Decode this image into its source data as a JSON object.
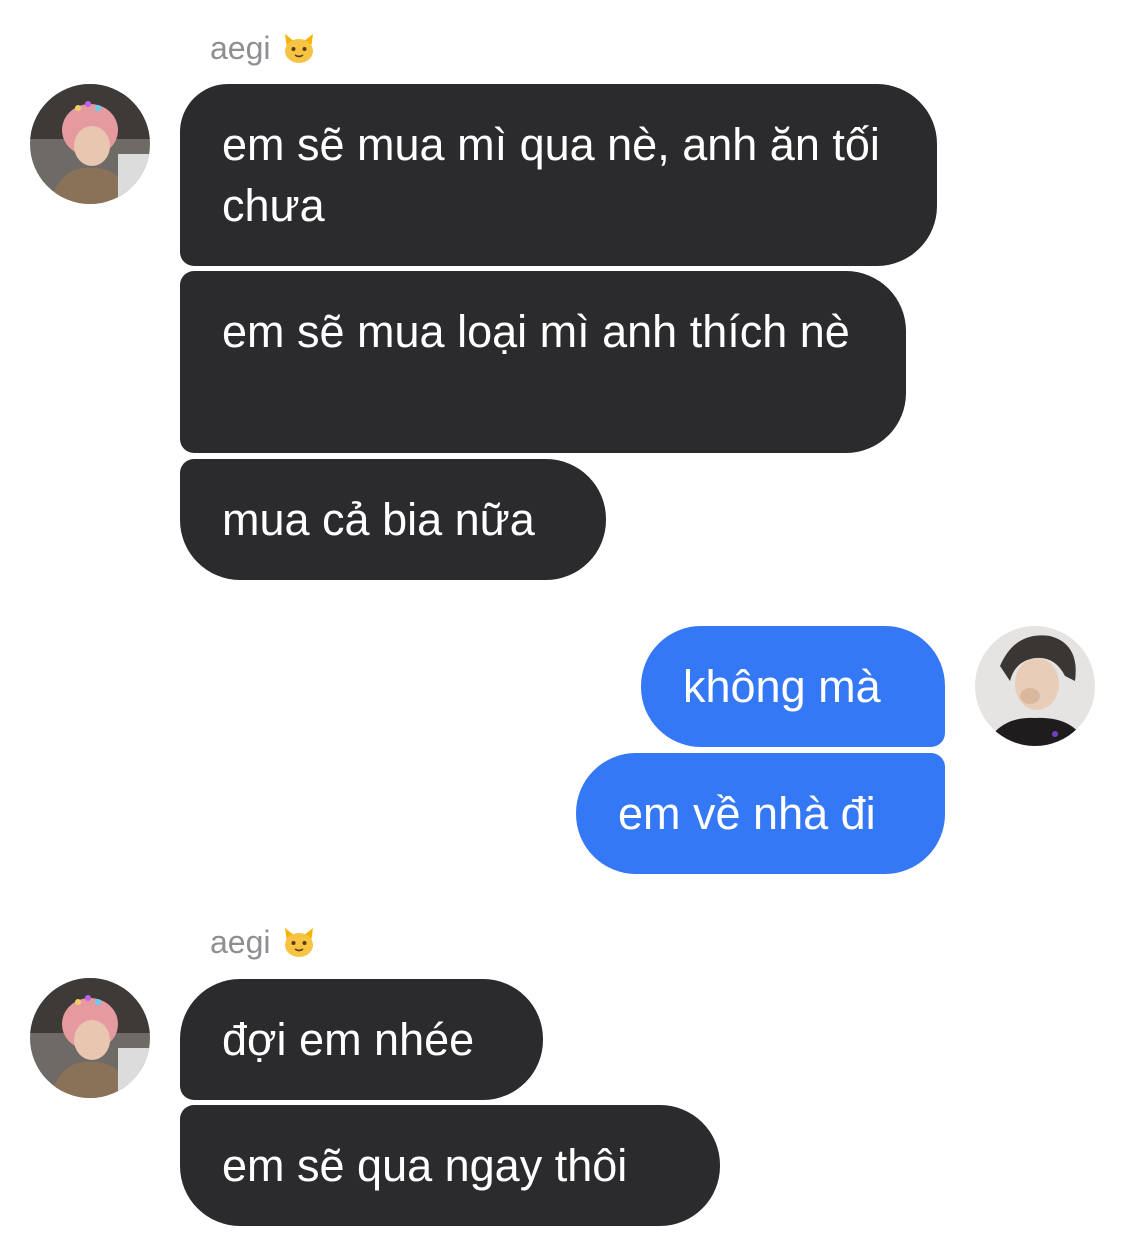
{
  "groups": [
    {
      "sender": "aegi",
      "sender_emoji": "cat-face",
      "messages": [
        "em sẽ mua mì qua nè, anh ăn tối chưa",
        "em sẽ mua loại mì anh thích nè",
        "mua cả bia nữa"
      ]
    },
    {
      "sender": "me",
      "messages": [
        "không mà",
        "em về nhà đi"
      ]
    },
    {
      "sender": "aegi",
      "sender_emoji": "cat-face",
      "messages": [
        "đợi em nhée",
        "em sẽ qua ngay thôi"
      ]
    }
  ],
  "colors": {
    "incoming_bubble": "#2b2b2e",
    "outgoing_bubble": "#3478f6",
    "sender_name": "#8e8e93"
  }
}
